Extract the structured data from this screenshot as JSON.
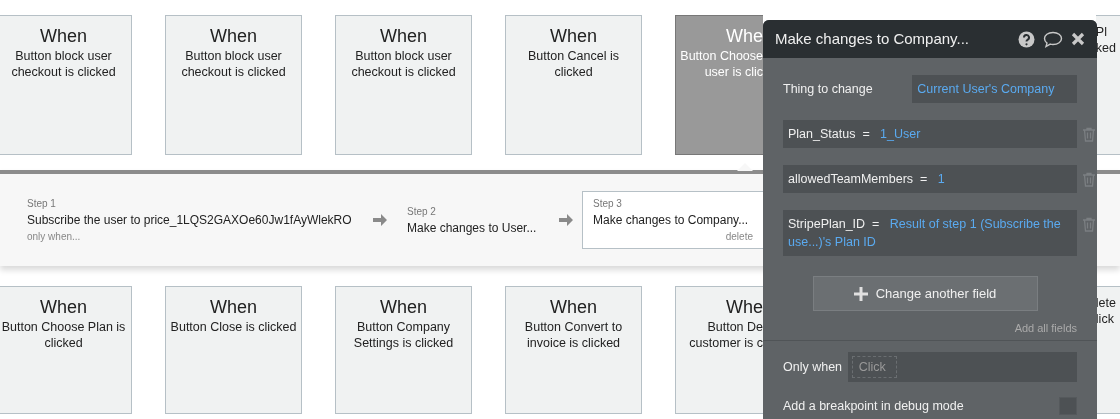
{
  "top_cards": [
    {
      "kind": "full",
      "title": "When",
      "lines": [
        "Button block user checkout is clicked"
      ],
      "selected": false
    },
    {
      "kind": "full",
      "title": "When",
      "lines": [
        "Button block user checkout is clicked"
      ],
      "selected": false
    },
    {
      "kind": "full",
      "title": "When",
      "lines": [
        "Button block user checkout is clicked"
      ],
      "selected": false
    },
    {
      "kind": "full",
      "title": "When",
      "lines": [
        "Button Cancel is clicked"
      ],
      "selected": false
    },
    {
      "kind": "clipped-left",
      "title": "Whe",
      "lines": [
        "Button Choose",
        "user is clic"
      ],
      "selected": true
    },
    {
      "kind": "clipped-right",
      "lines": [
        "Pl",
        "ked"
      ],
      "selected": false
    }
  ],
  "steps": [
    {
      "label": "Step 1",
      "text": "Subscribe the user to price_1LQS2GAXOe60Jw1fAyWlekRO",
      "note": "only when...",
      "selected": false
    },
    {
      "label": "Step 2",
      "text": "Make changes to User...",
      "selected": false
    },
    {
      "label": "Step 3",
      "text": "Make changes to Company...",
      "action": "delete",
      "selected": true
    }
  ],
  "bottom_cards": [
    {
      "kind": "full",
      "title": "When",
      "lines": [
        "Button Choose Plan is clicked"
      ],
      "selected": false
    },
    {
      "kind": "full",
      "title": "When",
      "lines": [
        "Button Close is clicked"
      ],
      "selected": false
    },
    {
      "kind": "full",
      "title": "When",
      "lines": [
        "Button Company Settings is clicked"
      ],
      "selected": false
    },
    {
      "kind": "full",
      "title": "When",
      "lines": [
        "Button Convert to invoice is clicked"
      ],
      "selected": false
    },
    {
      "kind": "clipped-left",
      "title": "Whe",
      "lines": [
        "Button De",
        "customer is c"
      ],
      "selected": false
    },
    {
      "kind": "clipped-right",
      "lines": [
        "lete",
        "lick"
      ],
      "selected": false
    }
  ],
  "panel": {
    "title": "Make changes to Company...",
    "thing_label": "Thing to change",
    "thing_value": "Current User's Company",
    "fields": [
      {
        "name": "Plan_Status",
        "operator": "=",
        "value": "1_User"
      },
      {
        "name": "allowedTeamMembers",
        "operator": "=",
        "value": "1"
      },
      {
        "name": "StripePlan_ID",
        "operator": "=",
        "value": "Result of step 1 (Subscribe the use...)'s Plan ID"
      }
    ],
    "add_button": "Change another field",
    "add_all": "Add all fields",
    "only_when_label": "Only when",
    "only_when_placeholder": "Click",
    "breakpoint_label": "Add a breakpoint in debug mode",
    "breakpoint_checked": false
  }
}
